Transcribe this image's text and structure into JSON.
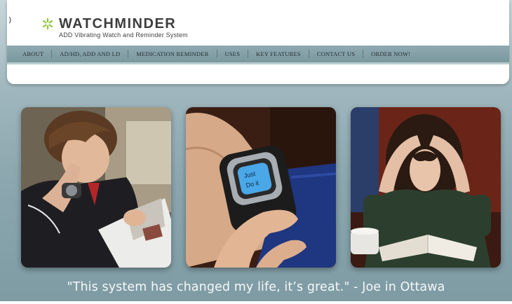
{
  "edge_mark": ")",
  "brand": {
    "name": "WATCHMINDER",
    "tagline": "ADD Vibrating Watch and Reminder System",
    "icon": "asterisk-logo-icon",
    "accent_color": "#8fc43f"
  },
  "nav": {
    "items": [
      {
        "label": "ABOUT"
      },
      {
        "label": "AD/HD, ADD AND LD"
      },
      {
        "label": "MEDICATION REMINDER"
      },
      {
        "label": "USES"
      },
      {
        "label": "KEY FEATURES"
      },
      {
        "label": "CONTACT US"
      },
      {
        "label": "ORDER NOW!"
      }
    ],
    "bar_color": "#86a1a9"
  },
  "photos": [
    {
      "subject": "boy-reading-magazine-wearing-watch"
    },
    {
      "subject": "wrist-with-watchminder-watch"
    },
    {
      "subject": "girl-studying-book"
    }
  ],
  "watch_display": {
    "line1": "Just",
    "line2": "Do it"
  },
  "testimonial": {
    "quote": "\"This system has changed my life, it’s great.\" -  Joe in Ottawa"
  }
}
